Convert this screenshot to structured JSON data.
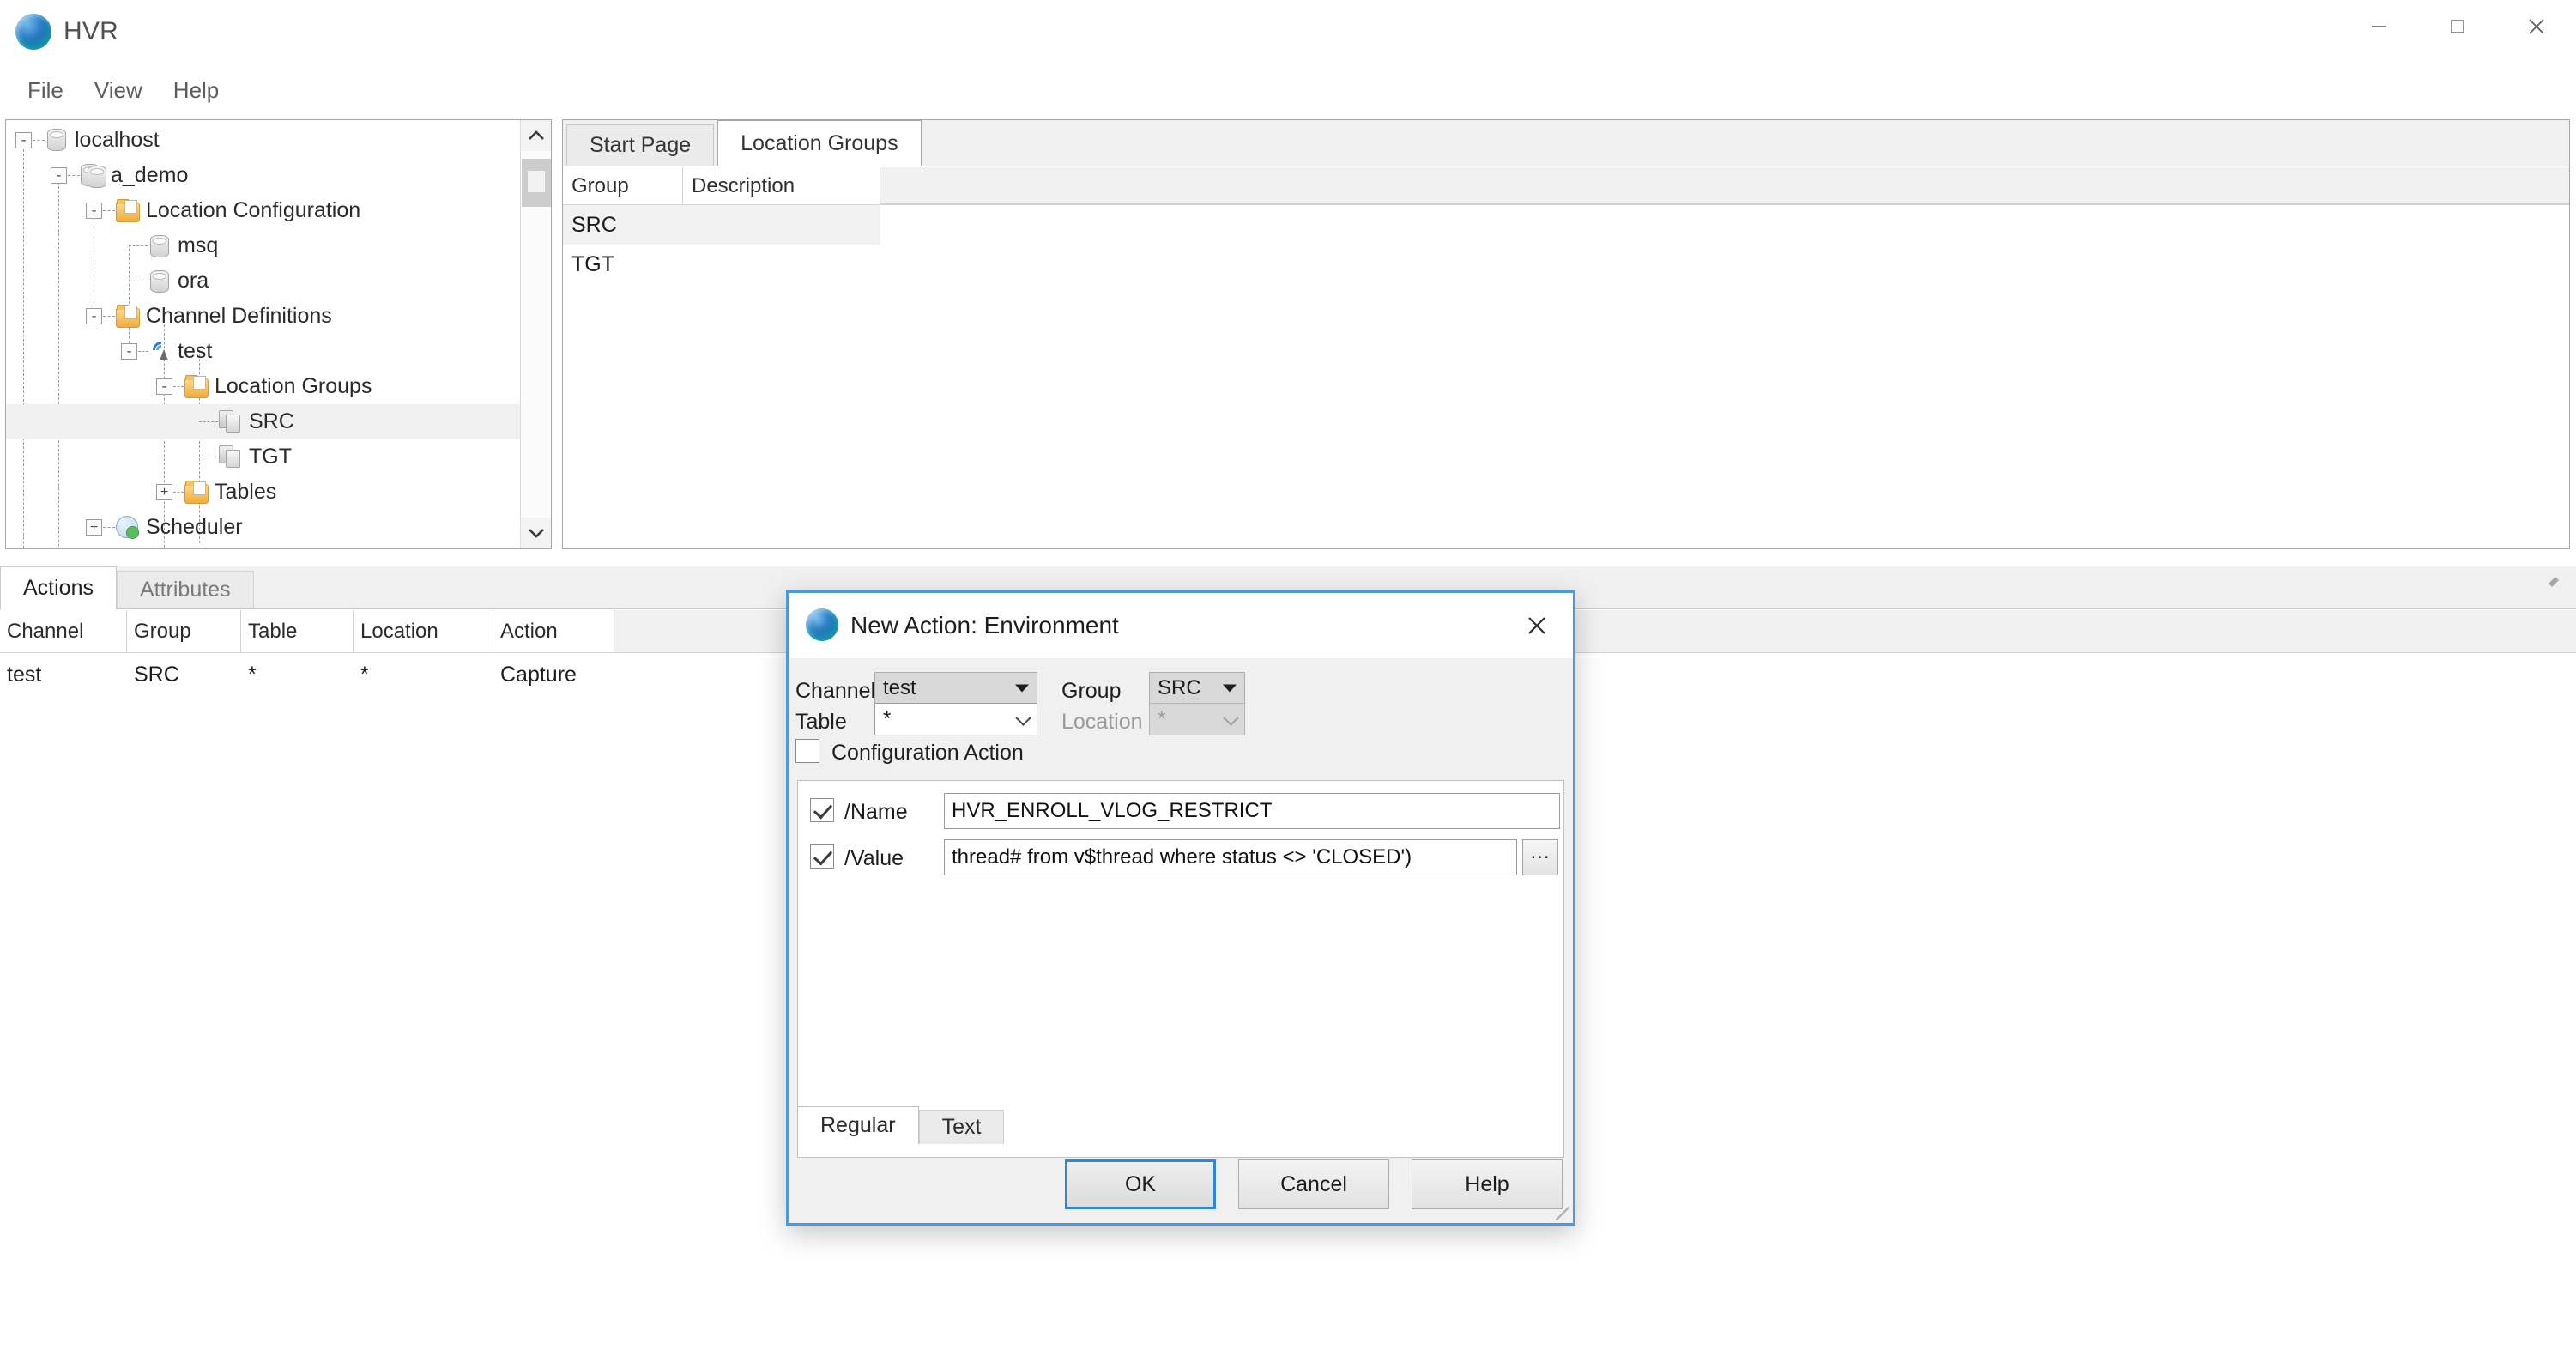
{
  "window": {
    "title": "HVR",
    "app_icon": "hvr-sphere-icon",
    "minimize": "—",
    "maximize": "□",
    "close": "✕"
  },
  "menubar": {
    "items": [
      {
        "label": "File"
      },
      {
        "label": "View"
      },
      {
        "label": "Help"
      }
    ]
  },
  "tree": {
    "nodes": [
      {
        "label": "localhost",
        "icon": "server-icon",
        "expander": "-",
        "depth": 0,
        "selected": false
      },
      {
        "label": "a_demo",
        "icon": "server-icon",
        "expander": "-",
        "depth": 1,
        "selected": false
      },
      {
        "label": "Location Configuration",
        "icon": "folder-icon",
        "expander": "-",
        "depth": 2,
        "selected": false
      },
      {
        "label": "msq",
        "icon": "database-icon",
        "expander": "",
        "depth": 3,
        "selected": false
      },
      {
        "label": "ora",
        "icon": "database-icon",
        "expander": "",
        "depth": 3,
        "selected": false
      },
      {
        "label": "Channel Definitions",
        "icon": "folder-icon",
        "expander": "-",
        "depth": 2,
        "selected": false
      },
      {
        "label": "test",
        "icon": "channel-icon",
        "expander": "-",
        "depth": 3,
        "selected": false
      },
      {
        "label": "Location Groups",
        "icon": "folder-icon",
        "expander": "-",
        "depth": 4,
        "selected": false
      },
      {
        "label": "SRC",
        "icon": "group-icon",
        "expander": "",
        "depth": 5,
        "selected": true
      },
      {
        "label": "TGT",
        "icon": "group-icon",
        "expander": "",
        "depth": 5,
        "selected": false
      },
      {
        "label": "Tables",
        "icon": "folder-icon",
        "expander": "+",
        "depth": 4,
        "selected": false
      },
      {
        "label": "Scheduler",
        "icon": "clock-icon",
        "expander": "+",
        "depth": 2,
        "selected": false
      }
    ],
    "scrollbar": {
      "up": "⌃",
      "down": "⌄"
    }
  },
  "main": {
    "tabs": [
      {
        "label": "Start Page",
        "active": false
      },
      {
        "label": "Location Groups",
        "active": true
      }
    ],
    "grid": {
      "columns": [
        "Group",
        "Description"
      ],
      "rows": [
        {
          "group": "SRC",
          "description": ""
        },
        {
          "group": "TGT",
          "description": ""
        }
      ]
    }
  },
  "bottom": {
    "tabs": [
      {
        "label": "Actions",
        "active": true
      },
      {
        "label": "Attributes",
        "active": false
      }
    ],
    "pin_icon": "auto-hide-pin-icon",
    "table": {
      "columns": [
        "Channel",
        "Group",
        "Table",
        "Location",
        "Action"
      ],
      "rows": [
        {
          "channel": "test",
          "group": "SRC",
          "table": "*",
          "location": "*",
          "action": "Capture"
        }
      ]
    }
  },
  "dialog": {
    "icon": "hvr-sphere-icon",
    "title": "New Action: Environment",
    "close_icon": "close-icon",
    "fields": {
      "channel_label": "Channel",
      "channel_value": "test",
      "group_label": "Group",
      "group_value": "SRC",
      "table_label": "Table",
      "table_value": "*",
      "location_label": "Location",
      "location_value": "*",
      "config_action_label": "Configuration Action",
      "config_action_checked": false
    },
    "parameters": [
      {
        "name": "/Name",
        "value": "HVR_ENROLL_VLOG_RESTRICT",
        "checked": true,
        "browse": false
      },
      {
        "name": "/Value",
        "value": "thread# from v$thread where status <> 'CLOSED')",
        "checked": true,
        "browse": true,
        "browse_label": "..."
      }
    ],
    "tabs": [
      {
        "label": "Regular",
        "active": true
      },
      {
        "label": "Text",
        "active": false
      }
    ],
    "buttons": [
      {
        "label": "OK",
        "primary": true
      },
      {
        "label": "Cancel",
        "primary": false
      },
      {
        "label": "Help",
        "primary": false
      }
    ]
  },
  "colors": {
    "accent_blue": "#2f86d8",
    "dialog_border": "#4a9bdd",
    "selection_grey": "#f1f1f1",
    "panel_grey": "#f0f0f0"
  }
}
